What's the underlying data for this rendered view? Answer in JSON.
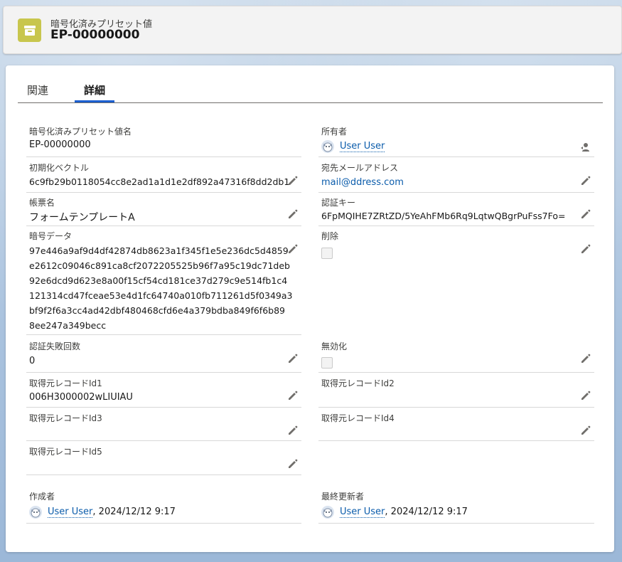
{
  "header": {
    "object_label": "暗号化済みプリセット値",
    "record_name": "EP-00000000"
  },
  "tabs": [
    {
      "label": "関連",
      "active": false
    },
    {
      "label": "詳細",
      "active": true
    }
  ],
  "fields": {
    "name": {
      "label": "暗号化済みプリセット値名",
      "value": "EP-00000000"
    },
    "owner": {
      "label": "所有者",
      "value": "User User"
    },
    "iv": {
      "label": "初期化ベクトル",
      "value": "6c9fb29b0118054cc8e2ad1a1d1e2df892a47316f8dd2db1"
    },
    "email": {
      "label": "宛先メールアドレス",
      "value": "mail@ddress.com"
    },
    "form": {
      "label": "帳票名",
      "value": "フォームテンプレートA"
    },
    "authkey": {
      "label": "認証キー",
      "value": "6FpMQIHE7ZRtZD/5YeAhFMb6Rq9LqtwQBgrPuFss7Fo="
    },
    "cipher": {
      "label": "暗号データ",
      "lines": [
        "97e446a9af9d4df42874db8623a1f345f1e5e236dc5d4859",
        "e2612c09046c891ca8cf2072205525b96f7a95c19dc71deb",
        "92e6dcd9d623e8a00f15cf54cd181ce37d279c9e514fb1c4",
        "121314cd47fceae53e4d1fc64740a010fb711261d5f0349a3",
        "bf9f2f6a3cc4ad42dbf480468cfd6e4a379bdba849f6f6b89",
        "8ee247a349becc"
      ]
    },
    "deleted": {
      "label": "削除",
      "checked": false
    },
    "authfail": {
      "label": "認証失敗回数",
      "value": "0"
    },
    "disabled": {
      "label": "無効化",
      "checked": false
    },
    "src1": {
      "label": "取得元レコードId1",
      "value": "006H3000002wLIUIAU"
    },
    "src2": {
      "label": "取得元レコードId2",
      "value": ""
    },
    "src3": {
      "label": "取得元レコードId3",
      "value": ""
    },
    "src4": {
      "label": "取得元レコードId4",
      "value": ""
    },
    "src5": {
      "label": "取得元レコードId5",
      "value": ""
    },
    "created": {
      "label": "作成者",
      "user": "User User",
      "datetime": ", 2024/12/12 9:17"
    },
    "modified": {
      "label": "最終更新者",
      "user": "User User",
      "datetime": ", 2024/12/12 9:17"
    }
  },
  "icons": {
    "header": "archive-box-icon",
    "edit": "pencil-icon",
    "avatar": "user-avatar-icon",
    "owner_change": "change-owner-icon"
  },
  "colors": {
    "accent": "#1b5fd0",
    "link": "#0b5cab",
    "header_icon_bg": "#c8c64d"
  }
}
